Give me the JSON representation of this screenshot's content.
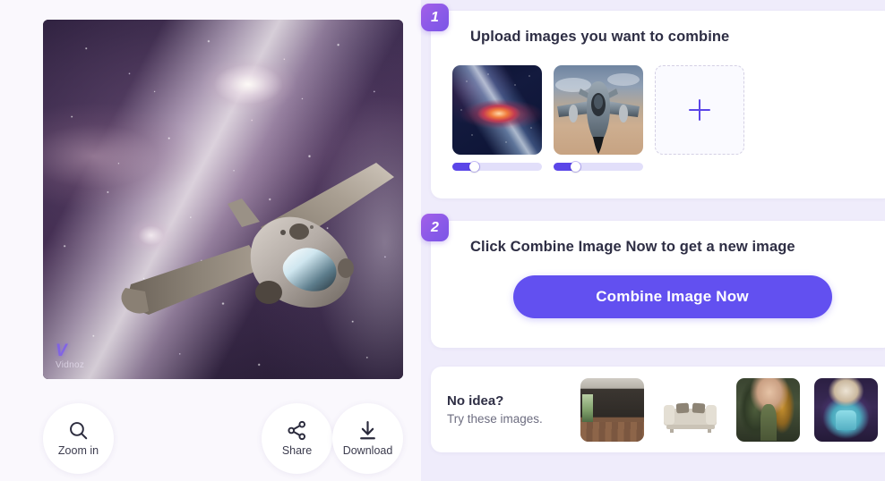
{
  "preview": {
    "alt": "Combined image result: jet aircraft flying through a purple galaxy",
    "watermark_logo": "V",
    "watermark_name": "Vidnoz"
  },
  "actions": [
    {
      "id": "zoom-in",
      "label": "Zoom in",
      "icon": "magnifier-icon"
    },
    {
      "id": "share",
      "label": "Share",
      "icon": "share-nodes-icon"
    },
    {
      "id": "download",
      "label": "Download",
      "icon": "download-arrow-icon"
    }
  ],
  "steps": {
    "upload": {
      "number": "1",
      "title": "Upload images you want to combine",
      "thumbnails": [
        {
          "id": "thumb-galaxy",
          "alt": "Colorful galaxy explosion",
          "slider_value": 24
        },
        {
          "id": "thumb-jet",
          "alt": "F-16 fighter jet in flight",
          "slider_value": 24
        }
      ],
      "add_button_label": "+"
    },
    "combine": {
      "number": "2",
      "title": "Click Combine Image Now to get a new image",
      "cta_label": "Combine Image Now"
    }
  },
  "ideas": {
    "title": "No idea?",
    "subtitle": "Try these images.",
    "samples": [
      {
        "id": "idea-room",
        "alt": "Dark empty interior room with wood floor"
      },
      {
        "id": "idea-sofa",
        "alt": "Beige three-seat sofa on white background"
      },
      {
        "id": "idea-woman",
        "alt": "Woman in a green gown with long hair"
      },
      {
        "id": "idea-char",
        "alt": "Blue-haired fantasy character"
      }
    ]
  },
  "colors": {
    "accent": "#6250f0",
    "badge_gradient_start": "#a35fe8",
    "badge_gradient_end": "#7b55e6",
    "slider_fill": "#5b46e8",
    "page_background": "#f8f6fc",
    "panel_background": "#efecfb",
    "card_background": "#ffffff"
  }
}
